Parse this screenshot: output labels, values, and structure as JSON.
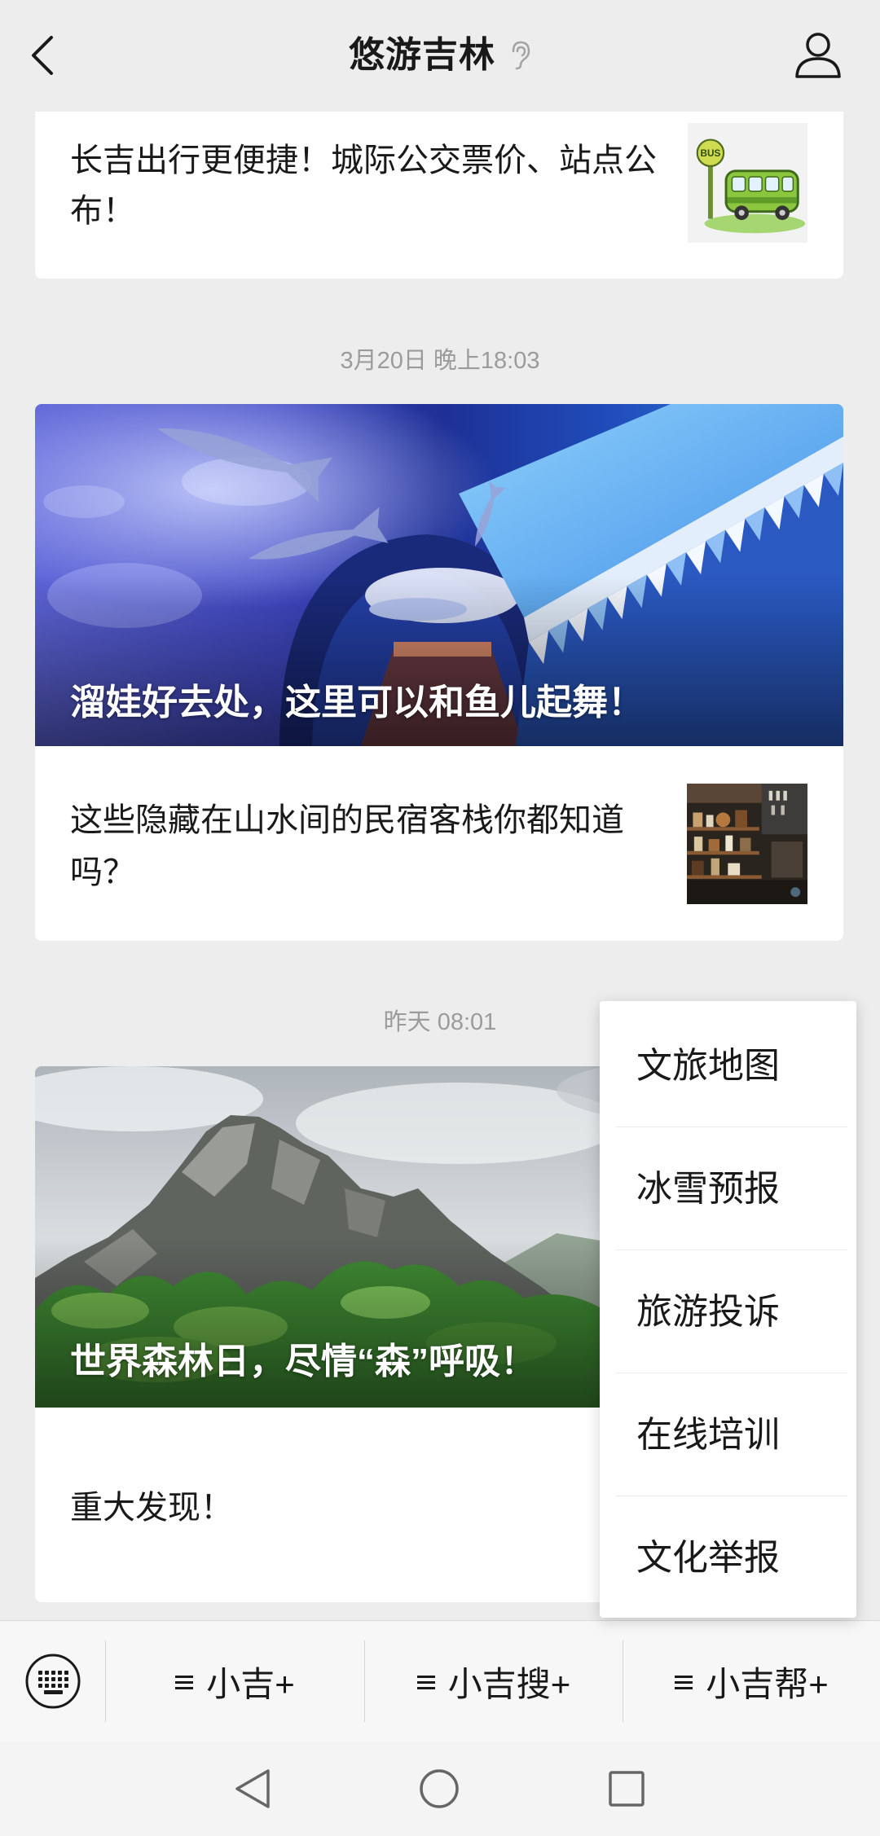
{
  "colors": {
    "background": "#ededed",
    "card": "#ffffff",
    "text": "#191919",
    "muted": "#9b9b9b",
    "popup": "#ffffff"
  },
  "header": {
    "title": "悠游吉林",
    "back_icon": "chevron-left-icon",
    "listen_icon": "ear-icon",
    "profile_icon": "person-icon"
  },
  "feed": [
    {
      "title": "长吉出行更便捷！城际公交票价、站点公布！",
      "thumb_sign": "BUS"
    },
    {
      "timestamp": "3月20日 晚上18:03",
      "cover_title": "溜娃好去处，这里可以和鱼儿起舞！",
      "sub_title": "这些隐藏在山水间的民宿客栈你都知道吗？"
    },
    {
      "timestamp": "昨天 08:01",
      "cover_title": "世界森林日，尽情“森”呼吸！",
      "sub_title": "重大发现！"
    }
  ],
  "popup_menu": {
    "items": [
      "文旅地图",
      "冰雪预报",
      "旅游投诉",
      "在线培训",
      "文化举报"
    ]
  },
  "bottom_menu": {
    "keyboard_icon": "keyboard-icon",
    "item_icon": "menu-lines-icon",
    "items": [
      "小吉+",
      "小吉搜+",
      "小吉帮+"
    ]
  },
  "system_nav": {
    "icons": [
      "nav-back-icon",
      "nav-home-icon",
      "nav-recents-icon"
    ]
  }
}
